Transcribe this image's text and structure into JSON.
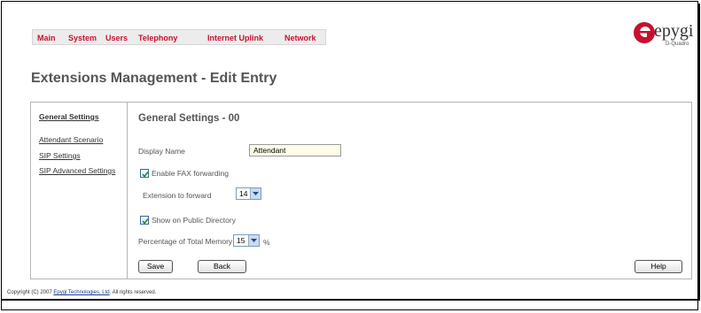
{
  "nav": {
    "items": [
      "Main",
      "System",
      "Users",
      "Telephony",
      "Internet Uplink",
      "Network"
    ]
  },
  "logo": {
    "brand": "epygi",
    "model": "D-Quadro"
  },
  "page_title": "Extensions Management - Edit Entry",
  "sidebar": {
    "items": [
      {
        "label": "General Settings",
        "active": true
      },
      {
        "label": "Attendant Scenario",
        "active": false
      },
      {
        "label": "SIP Settings",
        "active": false
      },
      {
        "label": "SIP Advanced Settings",
        "active": false
      }
    ]
  },
  "content": {
    "title": "General Settings - 00",
    "display_name_label": "Display Name",
    "display_name_value": "Attendant",
    "fax_forwarding_label": "Enable FAX forwarding",
    "fax_forwarding_checked": true,
    "ext_forward_label": "Extension to forward",
    "ext_forward_value": "14",
    "public_dir_label": "Show on Public Directory",
    "public_dir_checked": true,
    "memory_label": "Percentage of Total Memory",
    "memory_value": "15",
    "memory_unit": "%"
  },
  "buttons": {
    "save": "Save",
    "back": "Back",
    "help": "Help"
  },
  "footer": {
    "prefix": "Copyright (C) 2007 ",
    "company": "Epygi Technologies, Ltd",
    "suffix": ". All rights reserved."
  },
  "colors": {
    "nav_text": "#c8102e",
    "logo_red": "#c8102e",
    "input_bg": "#fffde6"
  }
}
